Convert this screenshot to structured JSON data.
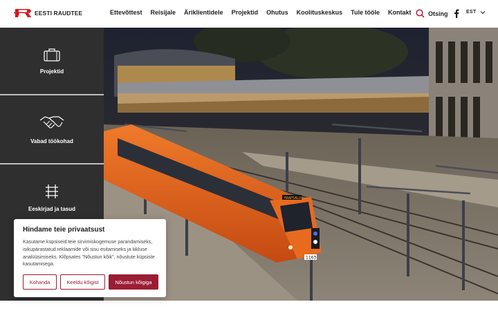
{
  "brand": {
    "name": "EESTI RAUDTEE",
    "accent": "#d71920",
    "button_color": "#9b1d33"
  },
  "nav": {
    "items": [
      "Ettevõttest",
      "Reisijale",
      "Äriklientidele",
      "Projektid",
      "Ohutus",
      "Koolituskeskus",
      "Tule tööle",
      "Kontakt"
    ]
  },
  "search": {
    "label": "Otsing",
    "icon": "search-icon"
  },
  "social": {
    "icon": "facebook-icon"
  },
  "language": {
    "selected": "EST",
    "icon": "chevron-down-icon"
  },
  "sidebar": {
    "tiles": [
      {
        "label": "Projektid",
        "icon": "briefcase-icon"
      },
      {
        "label": "Vabad töökohad",
        "icon": "handshake-icon"
      },
      {
        "label": "Eeskirjad ja tasud",
        "icon": "rail-track-icon"
      }
    ]
  },
  "hero": {
    "train_display": "HAAPSALU",
    "train_number": "1163"
  },
  "cookie": {
    "title": "Hindame teie privaatsust",
    "text": "Kasutame küpsiseid teie sirvimiskogemuse parandamiseks, isikupärastatud reklaamide või sisu esitamiseks ja liikluse analüüsimiseks. Klõpsates \"Nõustun kõik\", nõustute küpsiste kasutamisega.",
    "customize_label": "Kohanda",
    "reject_label": "Keeldu kõigist",
    "accept_label": "Nõustun kõigiga"
  }
}
